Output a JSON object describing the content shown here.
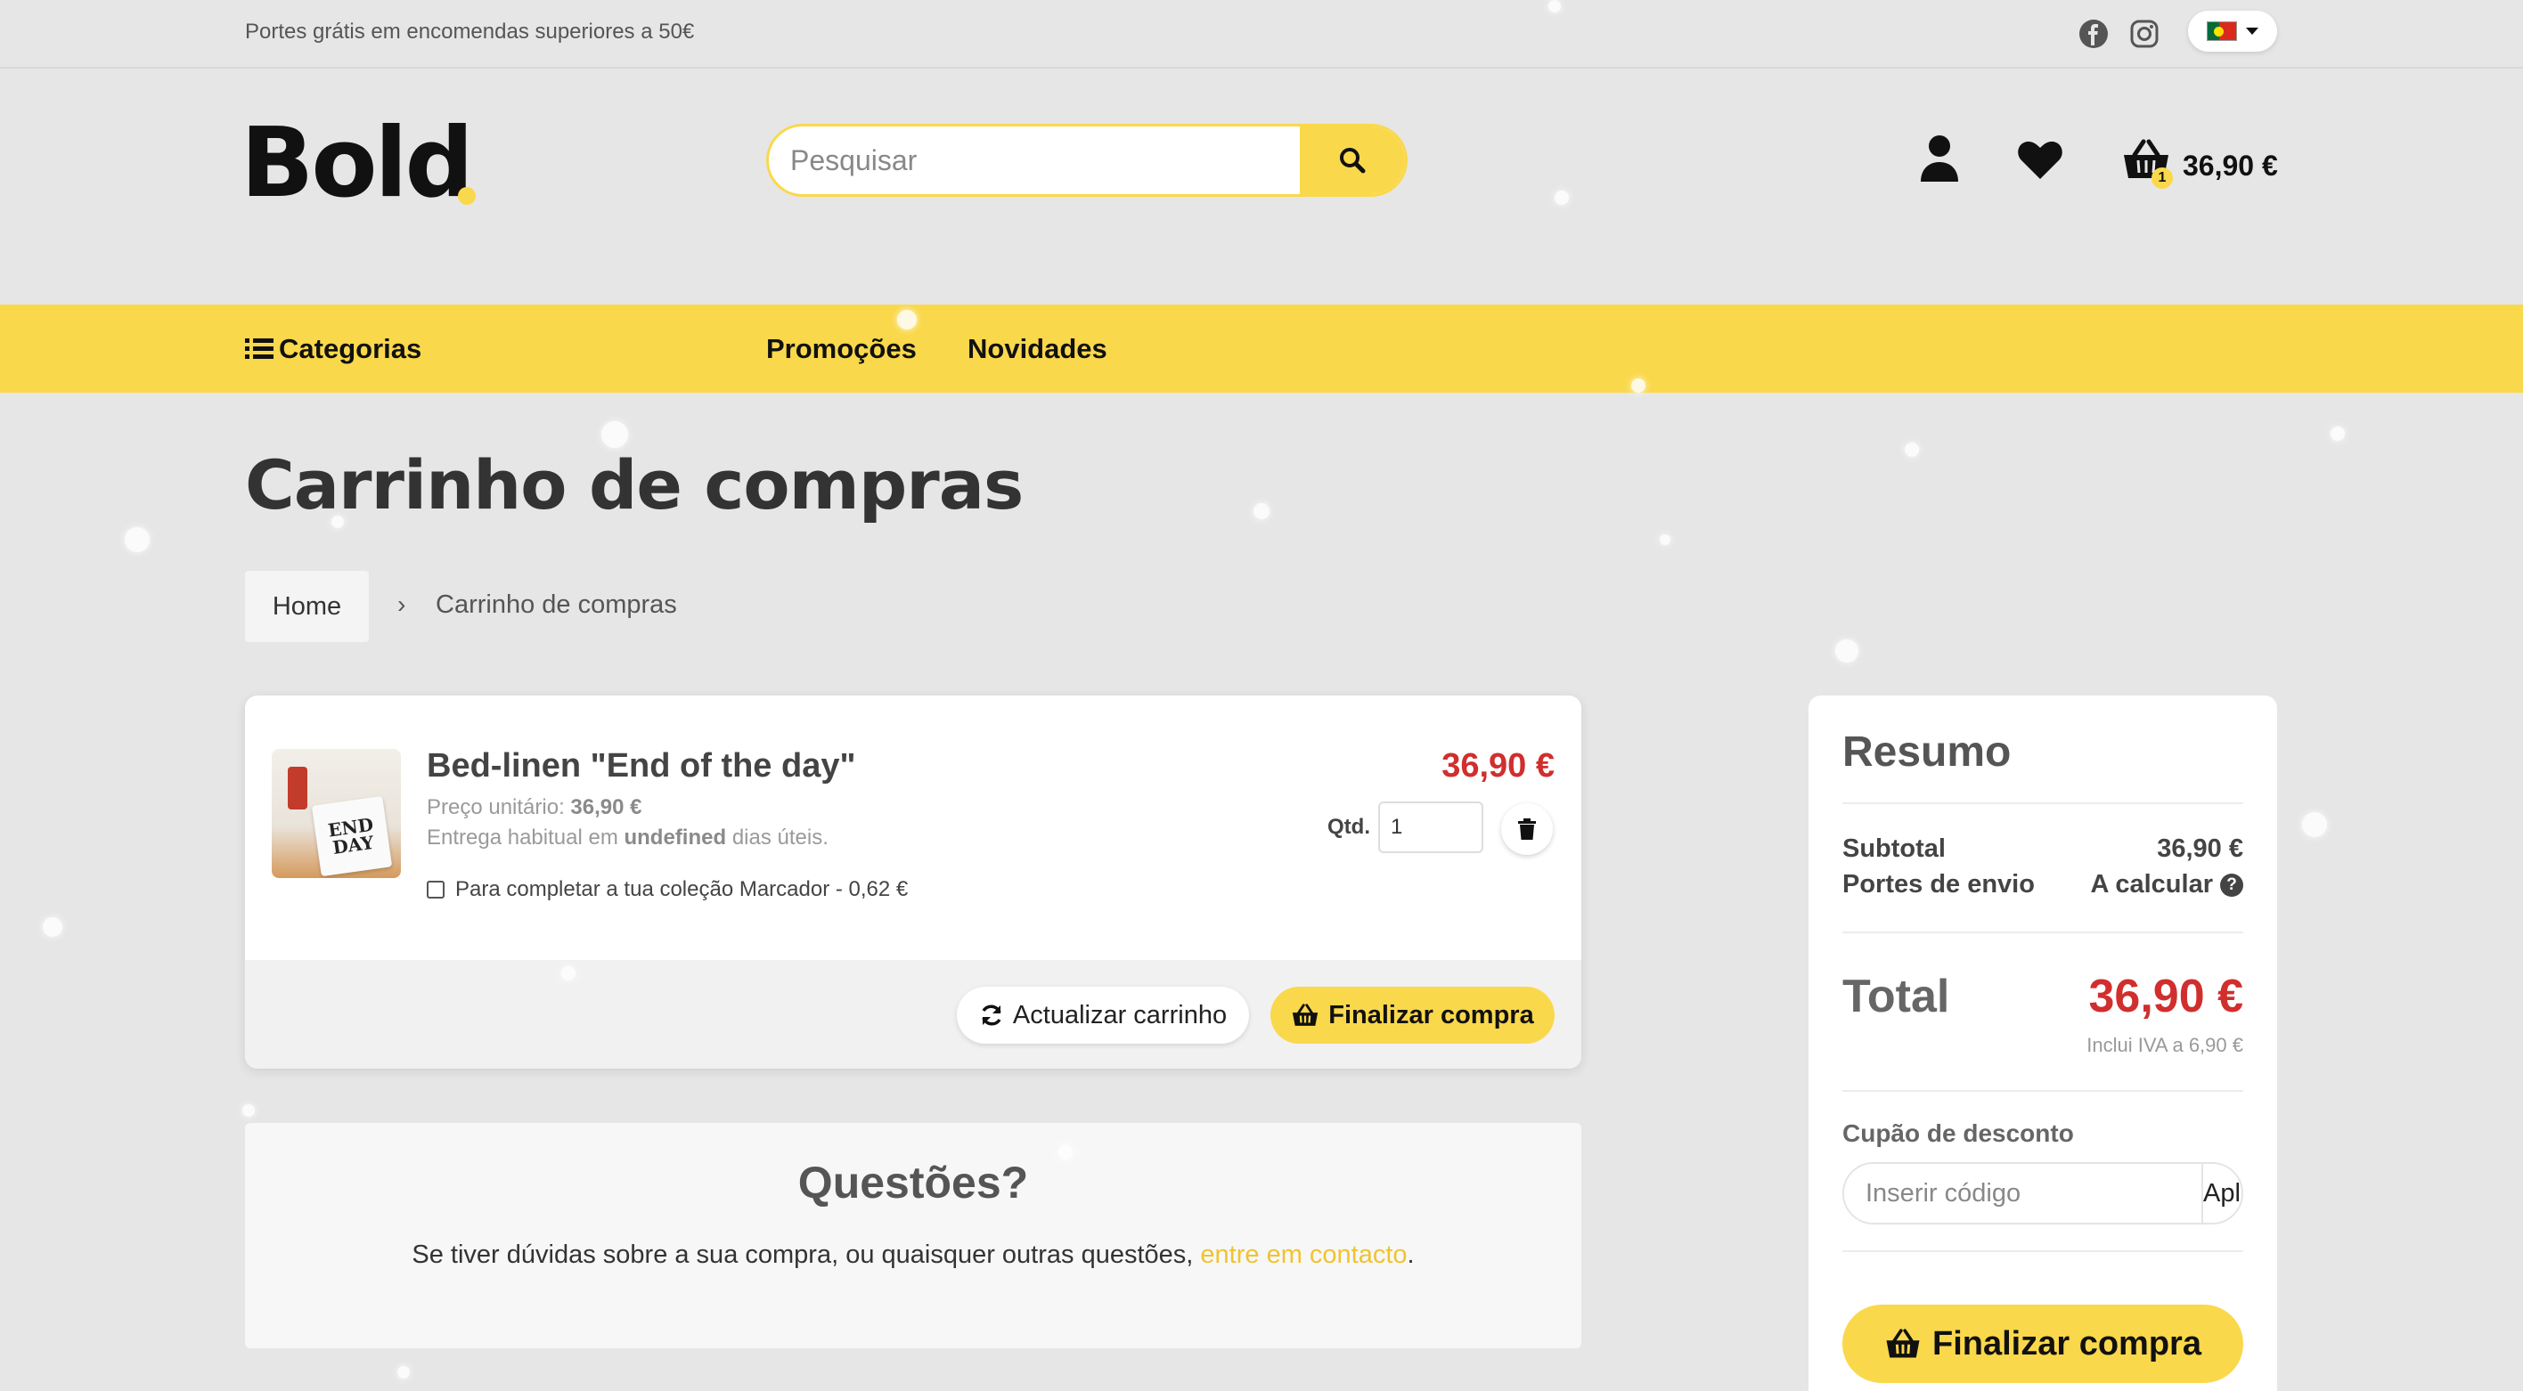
{
  "topbar": {
    "promo": "Portes grátis em encomendas superiores a 50€",
    "social_icons": [
      "facebook-icon",
      "instagram-icon"
    ],
    "language": "pt"
  },
  "header": {
    "logo_text": "Bold",
    "search_placeholder": "Pesquisar",
    "cart_total": "36,90 €",
    "cart_count": "1"
  },
  "nav": {
    "categories": "Categorias",
    "items": [
      "Promoções",
      "Novidades"
    ]
  },
  "page": {
    "title": "Carrinho de compras",
    "breadcrumb": {
      "home": "Home",
      "separator": "›",
      "current": "Carrinho de compras"
    }
  },
  "cart": {
    "items": [
      {
        "name": "Bed-linen \"End of the day\"",
        "unit_label": "Preço unitário:",
        "unit_price": "36,90 €",
        "delivery_prefix": "Entrega habitual em",
        "delivery_value": "undefined",
        "delivery_suffix": "dias úteis.",
        "addon": "Para completar a tua coleção Marcador - 0,62 €",
        "price": "36,90 €",
        "qty_label": "Qtd.",
        "qty": "1",
        "thumb_text": "END DAY"
      }
    ],
    "update_label": "Actualizar carrinho",
    "checkout_label": "Finalizar compra"
  },
  "questions": {
    "title": "Questões?",
    "text": "Se tiver dúvidas sobre a sua compra, ou quaisquer outras questões,",
    "link": "entre em contacto",
    "end": "."
  },
  "summary": {
    "title": "Resumo",
    "subtotal_label": "Subtotal",
    "subtotal_value": "36,90 €",
    "shipping_label": "Portes de envio",
    "shipping_value": "A calcular",
    "total_label": "Total",
    "total_value": "36,90 €",
    "vat_note": "Inclui IVA a 6,90 €",
    "coupon_label": "Cupão de desconto",
    "coupon_placeholder": "Inserir código",
    "apply_label": "Aplicar",
    "checkout_label": "Finalizar compra"
  },
  "colors": {
    "accent": "#fad84b",
    "price": "#d12e2e",
    "background": "#e6e6e6"
  }
}
